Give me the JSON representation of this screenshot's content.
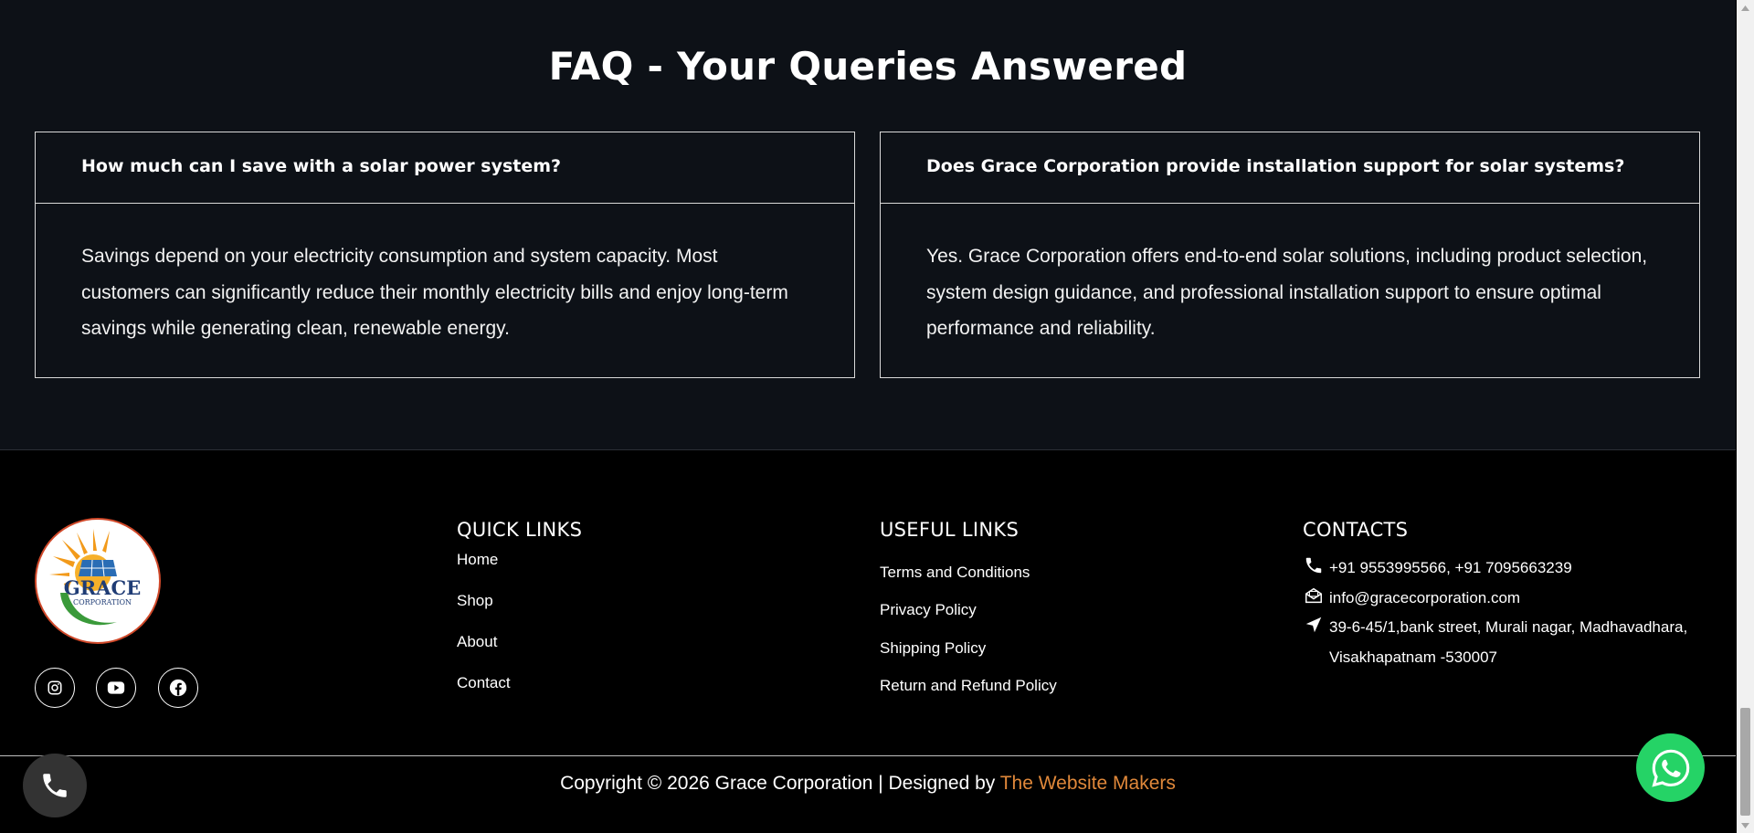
{
  "faq": {
    "title": "FAQ - Your Queries Answered",
    "items": [
      {
        "question": "How much can I save with a solar power system?",
        "answer": "Savings depend on your electricity consumption and system capacity. Most customers can significantly reduce their monthly electricity bills and enjoy long-term savings while generating clean, renewable energy."
      },
      {
        "question": "Does Grace Corporation provide installation support for solar systems?",
        "answer": "Yes. Grace Corporation offers end-to-end solar solutions, including product selection, system design guidance, and professional installation support to ensure optimal performance and reliability."
      }
    ]
  },
  "footer": {
    "logo": {
      "name": "GRACE",
      "sub": "CORPORATION",
      "colors": {
        "sun": "#f29a1a",
        "panel": "#2a6db5",
        "leaf": "#3a9a3a",
        "ring": "#d0492a"
      }
    },
    "social": [
      {
        "icon": "instagram-icon"
      },
      {
        "icon": "youtube-icon"
      },
      {
        "icon": "facebook-icon"
      }
    ],
    "quick_links": {
      "title": "QUICK LINKS",
      "items": [
        "Home",
        "Shop",
        "About",
        "Contact"
      ]
    },
    "useful_links": {
      "title": "USEFUL LINKS",
      "items": [
        "Terms and Conditions",
        "Privacy Policy",
        "Shipping Policy",
        "Return and Refund Policy"
      ]
    },
    "contacts": {
      "title": "CONTACTS",
      "phone": "+91 9553995566, +91 7095663239",
      "email": "info@gracecorporation.com",
      "address": "39-6-45/1,bank street, Murali nagar, Madhavadhara, Visakhapatnam -530007"
    },
    "copyright": {
      "text": "Copyright © 2026 Grace Corporation | Designed by ",
      "designer": "The Website Makers",
      "designer_color": "#e0883a"
    }
  },
  "floating": {
    "call_icon": "phone-icon",
    "whatsapp_icon": "whatsapp-icon",
    "whatsapp_color": "#25d366"
  },
  "colors": {
    "faq_background": "#0d1117",
    "footer_background": "#000000",
    "accent": "#e0883a"
  }
}
